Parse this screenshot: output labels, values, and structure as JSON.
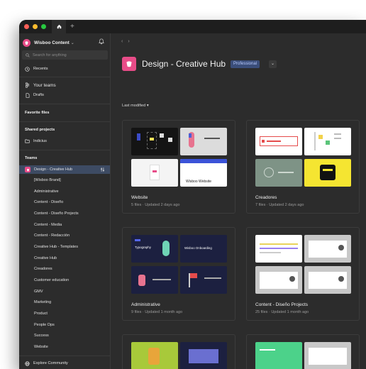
{
  "titlebar": {
    "home_icon": "home-icon",
    "new_tab": "+"
  },
  "sidebar": {
    "workspace": {
      "name": "Wisboo Content",
      "chevron": "⌄"
    },
    "search_placeholder": "Search for anything",
    "recents": "Recents",
    "your_teams": "Your teams",
    "drafts": "Drafts",
    "favorite_files": "Favorite files",
    "shared_projects": "Shared projects",
    "shared_project_items": [
      "Indicius"
    ],
    "teams_label": "Teams",
    "teams": [
      "Design - Creative Hub",
      "[Wisboo Brand]",
      "Administrative",
      "Content - Diseño",
      "Content - Diseño Projects",
      "Content - Media",
      "Content - Redacción",
      "Creative Hub - Templates",
      "Creative Hub",
      "Creadores",
      "Customer education",
      "GMV",
      "Marketing",
      "Product",
      "People Ops",
      "Success",
      "Website"
    ],
    "explore": "Explore Community"
  },
  "main": {
    "title": "Design - Creative Hub",
    "plan_badge": "Professional",
    "sort": "Last modified",
    "projects": [
      {
        "title": "Website",
        "meta": "5 files · Updated 2 days ago"
      },
      {
        "title": "Creadores",
        "meta": "7 files · Updated 2 days ago"
      },
      {
        "title": "Administrative",
        "meta": "9 files · Updated 1 month ago"
      },
      {
        "title": "Content - Diseño Projects",
        "meta": "25 files · Updated 1 month ago"
      }
    ],
    "thumb_texts": {
      "wisboo_website": "Wisboo Website",
      "typography": "Typography",
      "wisboo_onboarding": "Wisboo Onboarding"
    }
  },
  "colors": {
    "brand": "#e84c88",
    "badge_bg": "#3b4e7a",
    "active_team": "#3d4b63"
  }
}
